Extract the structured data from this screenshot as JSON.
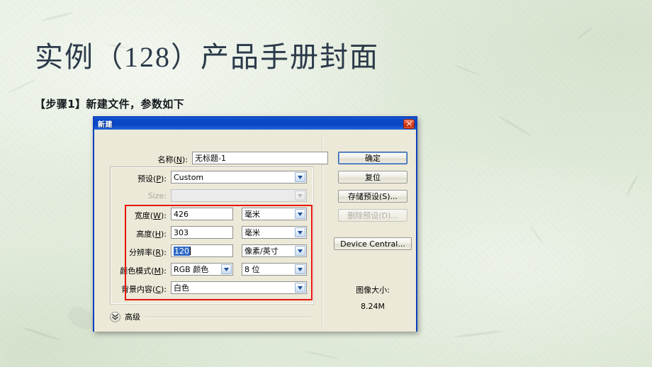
{
  "slide": {
    "title": "实例（128）产品手册封面",
    "step_label": "【步骤1】新建文件，参数如下",
    "background_color": "#e3ecdc"
  },
  "dialog": {
    "title": "新建",
    "close_icon": "close-icon",
    "titlebar_color": "#0a45c3",
    "border_color": "#0b3fbe",
    "face_color": "#ece9d8",
    "fields": {
      "name": {
        "label": "名称(N):",
        "mnemonic": "N",
        "value": "无标题-1"
      },
      "preset": {
        "label": "预设(P):",
        "mnemonic": "P",
        "value": "Custom"
      },
      "size": {
        "label": "Size:",
        "value": "",
        "disabled": true
      },
      "width": {
        "label": "宽度(W):",
        "mnemonic": "W",
        "value": "426",
        "unit": "毫米"
      },
      "height": {
        "label": "高度(H):",
        "mnemonic": "H",
        "value": "303",
        "unit": "毫米"
      },
      "resolution": {
        "label": "分辨率(R):",
        "mnemonic": "R",
        "value": "120",
        "unit": "像素/英寸",
        "selected": true
      },
      "color_mode": {
        "label": "颜色模式(M):",
        "mnemonic": "M",
        "value": "RGB 颜色",
        "depth": "8 位"
      },
      "background_contents": {
        "label": "背景内容(C):",
        "mnemonic": "C",
        "value": "白色"
      }
    },
    "buttons": {
      "ok": "确定",
      "reset": "复位",
      "save_preset": "存储预设(S)...",
      "save_preset_mnemonic": "S",
      "delete_preset": "删除预设(D)...",
      "delete_preset_mnemonic": "D",
      "delete_preset_disabled": true,
      "device_central": "Device Central...",
      "device_central_mnemonic": "e"
    },
    "image_size": {
      "label": "图像大小:",
      "value": "8.24M"
    },
    "advanced": {
      "label": "高级",
      "chevron_icon": "chevron-double-down-icon",
      "expanded": false
    },
    "highlight": {
      "color": "#e8150d",
      "note": "red annotation box around size/resolution/mode fields"
    }
  }
}
